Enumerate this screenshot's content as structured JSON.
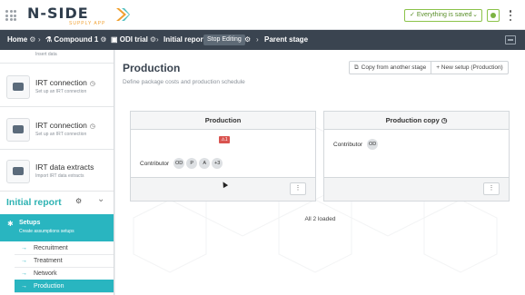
{
  "header": {
    "logo_text": "N-SIDE",
    "logo_sub": "SUPPLY APP",
    "save_status": "Everything is saved",
    "colors": {
      "accent": "#29b5c0",
      "ok": "#7cb342",
      "dark": "#3a4450",
      "warn": "#d9534f"
    }
  },
  "breadcrumb": {
    "home": "Home",
    "compound": "Compound 1",
    "trial": "ODI trial",
    "report": "Initial report",
    "stop_editing": "Stop Editing",
    "stage": "Parent stage"
  },
  "sidebar": {
    "top_partial_sub": "Insert data",
    "cards": [
      {
        "title": "IRT connection",
        "sub": "Set up an IRT connection"
      },
      {
        "title": "IRT connection",
        "sub": "Set up an IRT connection"
      },
      {
        "title": "IRT data extracts",
        "sub": "Import IRT data extracts"
      }
    ],
    "section": "Initial report",
    "setups": {
      "label": "Setups",
      "sub": "Create assumptions setups"
    },
    "items": [
      "Recruitment",
      "Treatment",
      "Network",
      "Production"
    ]
  },
  "main": {
    "title": "Production",
    "subtitle": "Define package costs and production schedule",
    "buttons": {
      "copy": "Copy from another stage",
      "new_setup": "+ New setup (Production)"
    },
    "panels": [
      {
        "title": "Production",
        "badge": "⚠1",
        "contributor_label": "Contributor",
        "avatars": [
          "OD",
          "P",
          "A",
          "+3"
        ]
      },
      {
        "title": "Production copy",
        "contributor_label": "Contributor",
        "avatars": [
          "OD"
        ]
      }
    ],
    "loaded": "All 2 loaded"
  }
}
